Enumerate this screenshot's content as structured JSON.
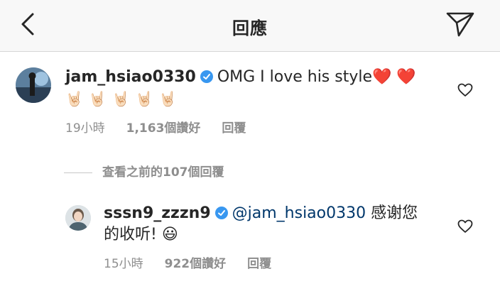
{
  "header": {
    "title": "回應"
  },
  "comments": [
    {
      "username": "jam_hsiao0330",
      "text": "OMG I love his style",
      "emoji_line": "🤘🏻🤘🏻🤘🏻🤘🏻🤘🏻",
      "hearts": "❤️ ❤️",
      "time": "19小時",
      "likes": "1,163個讚好",
      "reply_label": "回覆"
    },
    {
      "username": "sssn9_zzzn9",
      "mention": "@jam_hsiao0330",
      "text_line1": " 感谢您",
      "text_line2": "的收听!",
      "smiley": "😃",
      "time": "15小時",
      "likes": "922個讚好",
      "reply_label": "回覆"
    }
  ],
  "view_previous": "查看之前的107個回覆",
  "colors": {
    "verified": "#3897f0",
    "mention": "#00376b",
    "meta": "#8e8e8e"
  }
}
